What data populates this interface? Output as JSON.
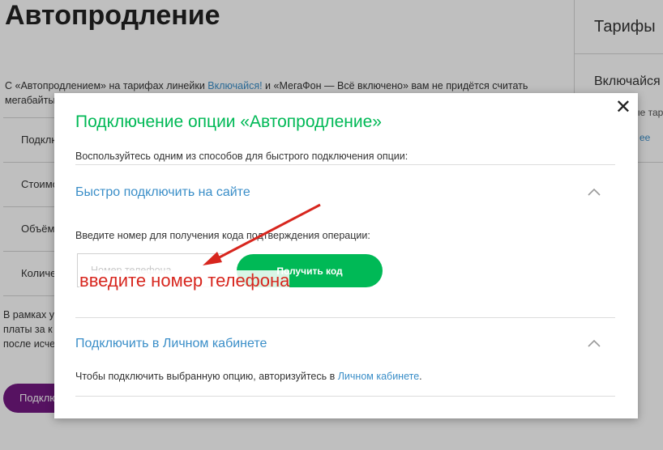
{
  "background": {
    "title": "Автопродление",
    "intro": {
      "text_before": "С «Автопродлением» на тарифах линейки ",
      "link": "Включайся!",
      "text_after": " и «МегаФон — Всё включено» вам не придётся считать мегабайты"
    },
    "rows": [
      {
        "label": "Подключ"
      },
      {
        "label": "Стоимо"
      },
      {
        "label": "Объём"
      },
      {
        "label": "Количе"
      }
    ],
    "note": "В рамках у\nплаты за к\nпосле исче",
    "button_label": "Подклю"
  },
  "sidebar": {
    "title": "Тарифы",
    "subtitle": "Включайся",
    "text": "ые тари",
    "link": "ее"
  },
  "modal": {
    "close_label": "✕",
    "title": "Подключение опции «Автопродление»",
    "description": "Воспользуйтесь одним из способов для быстрого подключения опции:",
    "section1": {
      "title": "Быстро подключить на сайте",
      "instruction": "Введите номер для получения кода подтверждения операции:",
      "phone_placeholder": "Номер телефона",
      "button_label": "Получить код"
    },
    "annotation": "введите номер телефона",
    "section2": {
      "title": "Подключить в Личном кабинете",
      "text_before": "Чтобы подключить выбранную опцию, авторизуйтесь в ",
      "link": "Личном кабинете",
      "text_after": "."
    }
  },
  "colors": {
    "brand_green": "#00b956",
    "link_blue": "#3a8ec8",
    "brand_purple": "#731982",
    "annotation_red": "#d7261e"
  },
  "icons": {
    "close": "close-icon",
    "collapse": "chevron-up-icon",
    "annotation_arrow": "arrow-icon"
  }
}
